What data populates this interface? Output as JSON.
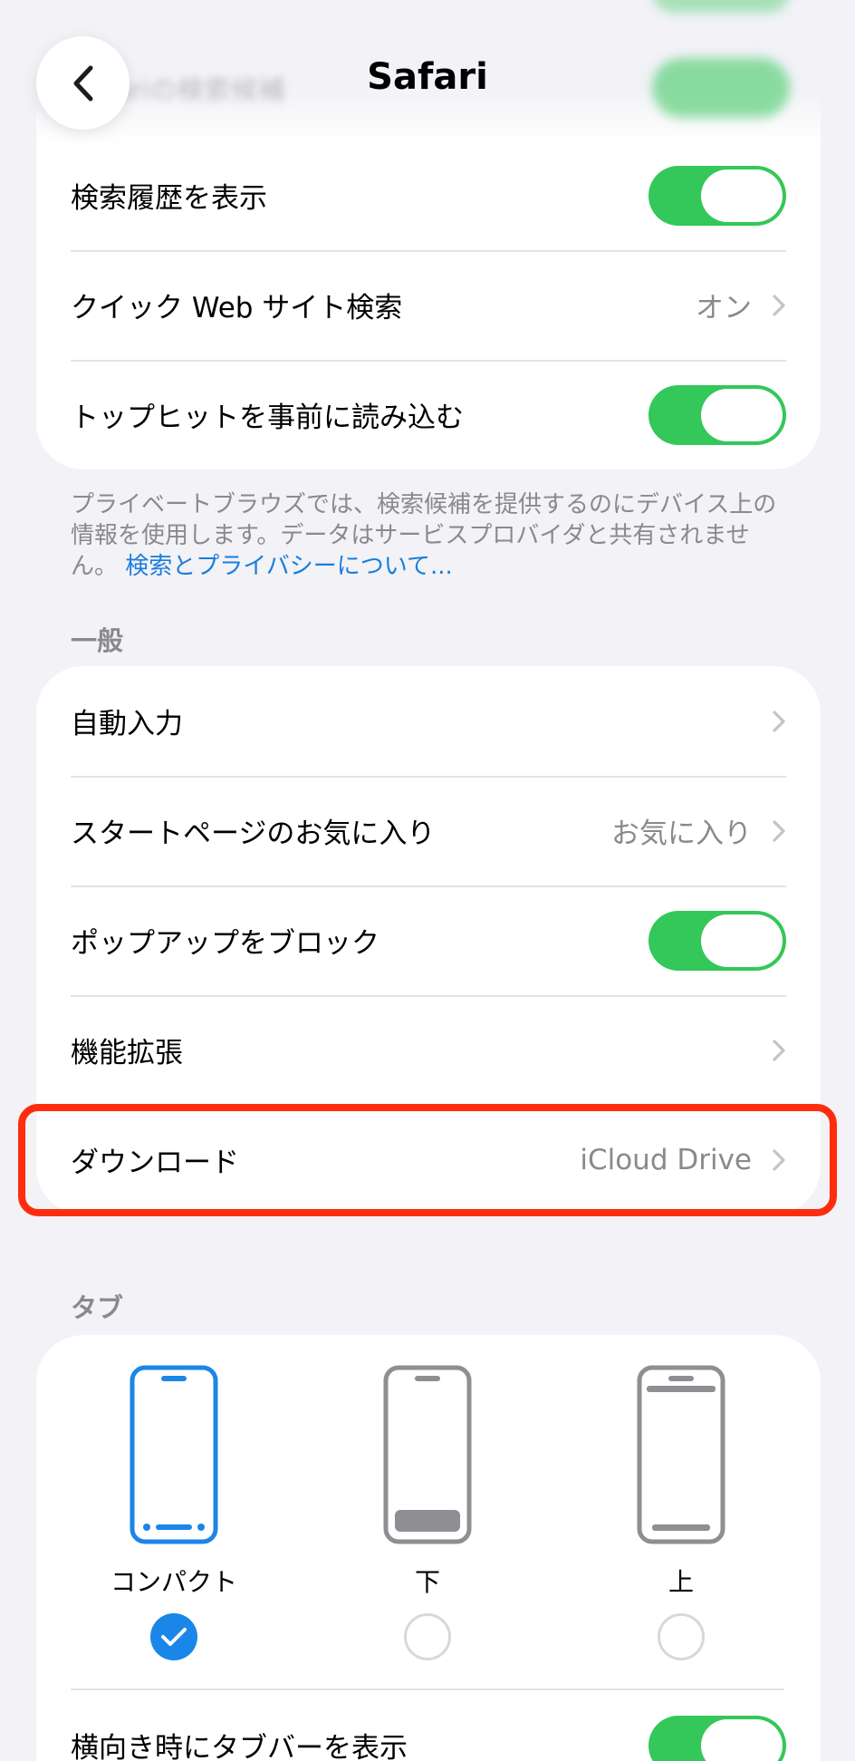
{
  "nav": {
    "title": "Safari",
    "blurred_row_label": "Safariの検索候補"
  },
  "search_section": {
    "rows": [
      {
        "label": "検索履歴を表示",
        "toggle": true
      },
      {
        "label": "クイック Web サイト検索",
        "value": "オン"
      },
      {
        "label": "トップヒットを事前に読み込む",
        "toggle": true
      }
    ],
    "footnote": "プライベートブラウズでは、検索候補を提供するのにデバイス上の情報を使用します。データはサービスプロバイダと共有されません。",
    "footnote_link": "検索とプライバシーについて..."
  },
  "general_section": {
    "header": "一般",
    "rows": [
      {
        "label": "自動入力"
      },
      {
        "label": "スタートページのお気に入り",
        "value": "お気に入り"
      },
      {
        "label": "ポップアップをブロック",
        "toggle": true
      },
      {
        "label": "機能拡張"
      },
      {
        "label": "ダウンロード",
        "value": "iCloud Drive"
      }
    ]
  },
  "tabs_section": {
    "header": "タブ",
    "options": [
      {
        "label": "コンパクト",
        "selected": true
      },
      {
        "label": "下",
        "selected": false
      },
      {
        "label": "上",
        "selected": false
      }
    ],
    "landscape_row": {
      "label": "横向き時にタブバーを表示",
      "toggle": true
    }
  },
  "colors": {
    "accent": "#1a86e8",
    "toggle_on": "#34c759",
    "highlight": "#ff2d0e"
  }
}
